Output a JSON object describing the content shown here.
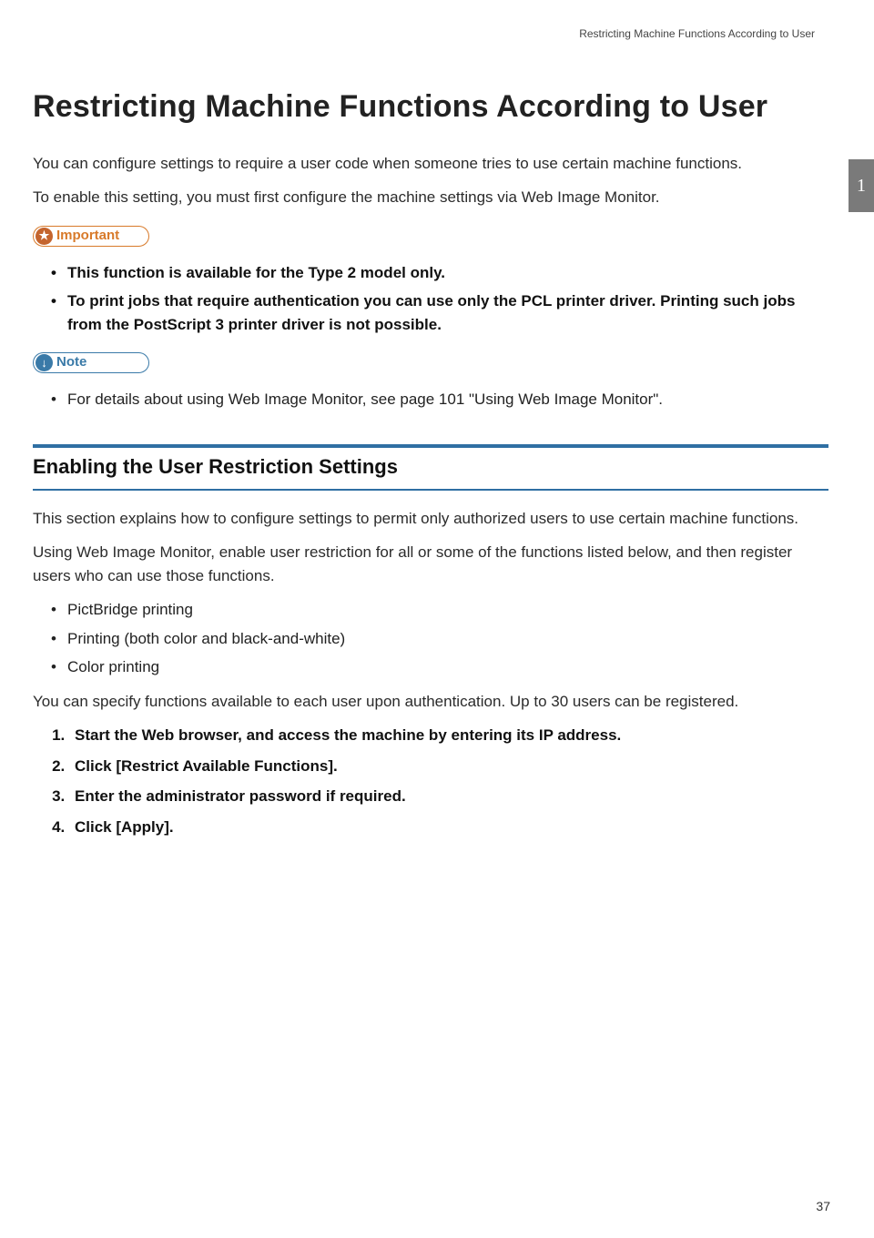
{
  "running_header": "Restricting Machine Functions According to User",
  "chapter_tab": "1",
  "title": "Restricting Machine Functions According to User",
  "intro_p1": "You can configure settings to require a user code when someone tries to use certain machine functions.",
  "intro_p2": "To enable this setting, you must first configure the machine settings via Web Image Monitor.",
  "callout_important_label": "Important",
  "callout_important_badge": "★",
  "important_items": [
    "This function is available for the Type 2 model only.",
    "To print jobs that require authentication you can use only the PCL printer driver. Printing such jobs from the PostScript 3 printer driver is not possible."
  ],
  "callout_note_label": "Note",
  "callout_note_badge": "↓",
  "note_items": [
    "For details about using Web Image Monitor, see page 101 \"Using Web Image Monitor\"."
  ],
  "section_heading": "Enabling the User Restriction Settings",
  "section_p1": "This section explains how to configure settings to permit only authorized users to use certain machine functions.",
  "section_p2": "Using Web Image Monitor, enable user restriction for all or some of the functions listed below, and then register users who can use those functions.",
  "function_list": [
    "PictBridge printing",
    "Printing (both color and black-and-white)",
    "Color printing"
  ],
  "section_p3": "You can specify functions available to each user upon authentication. Up to 30 users can be registered.",
  "steps": [
    "Start the Web browser, and access the machine by entering its IP address.",
    "Click [Restrict Available Functions].",
    "Enter the administrator password if required.",
    "Click [Apply]."
  ],
  "page_number": "37"
}
